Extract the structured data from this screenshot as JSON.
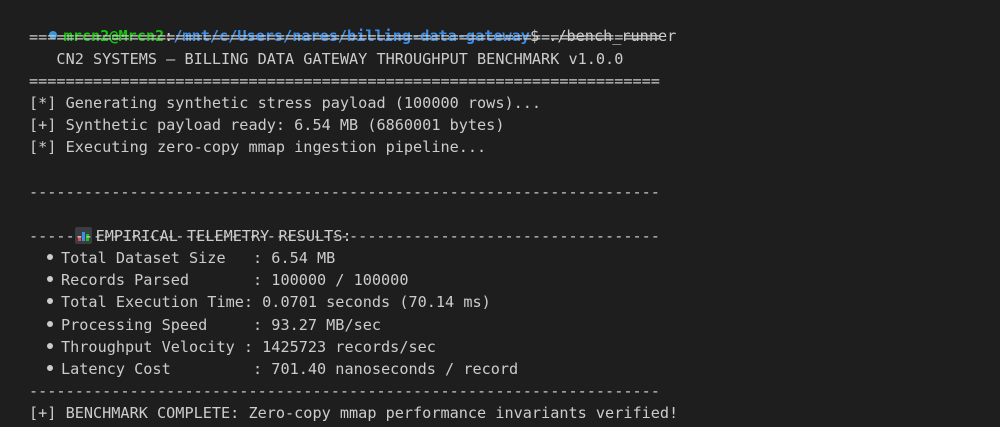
{
  "prompt": {
    "user_host": "mrcn2@Mrcn2",
    "separator": ":",
    "path": "/mnt/c/Users/nares/billing-data-gateway",
    "symbol": "$",
    "command": " ./bench_runner"
  },
  "banner": {
    "rule_double": "=====================================================================",
    "title": "   CN2 SYSTEMS — BILLING DATA GATEWAY THROUGHPUT BENCHMARK v1.0.0"
  },
  "log": [
    "[*] Generating synthetic stress payload (100000 rows)...",
    "[+] Synthetic payload ready: 6.54 MB (6860001 bytes)",
    "[*] Executing zero-copy mmap ingestion pipeline..."
  ],
  "results": {
    "rule_single": "---------------------------------------------------------------------",
    "heading": "EMPIRICAL TELEMETRY RESULTS:",
    "heading_icon": "bar-chart-icon",
    "items": [
      "Total Dataset Size   : 6.54 MB",
      "Records Parsed       : 100000 / 100000",
      "Total Execution Time: 0.0701 seconds (70.14 ms)",
      "Processing Speed     : 93.27 MB/sec",
      "Throughput Velocity : 1425723 records/sec",
      "Latency Cost         : 701.40 nanoseconds / record"
    ]
  },
  "final": "[+] BENCHMARK COMPLETE: Zero-copy mmap performance invariants verified!",
  "colors": {
    "background": "#1e1e1e",
    "text": "#cccccc",
    "user_host": "#16c60c",
    "path": "#3b8eea",
    "prompt_dot": "#3a96dd"
  }
}
